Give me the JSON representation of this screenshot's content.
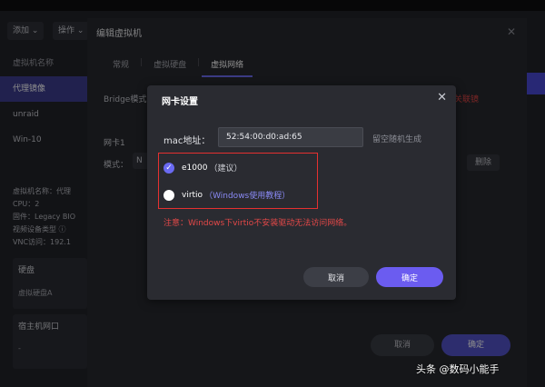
{
  "toolbar": {
    "add": "添加 ⌄",
    "ops": "操作 ⌄"
  },
  "vm_list": {
    "header": "虚拟机名称",
    "items": [
      "代理镜像",
      "unraid",
      "Win-10"
    ]
  },
  "vm_info": {
    "lines": [
      "虚拟机名称：代理",
      "CPU：2",
      "固件：Legacy BIO",
      "视频设备类型 ⓘ",
      "VNC访问：192.1"
    ],
    "disk_title": "硬盘",
    "disk_value": "虚拟硬盘A",
    "port_title": "宿主机网口",
    "port_value": "-"
  },
  "edit_dialog": {
    "title": "编辑虚拟机",
    "tabs": [
      "常规",
      "虚拟硬盘",
      "虚拟网络"
    ],
    "bridge_text": "Bridge模式",
    "warn_side": "关联镜",
    "nic_header": "网卡1",
    "mode_label": "模式：",
    "mode_value": "N",
    "delete_label": "删除",
    "cancel_label": "取消",
    "ok_label": "确定"
  },
  "nic_dialog": {
    "title": "网卡设置",
    "mac_label": "mac地址：",
    "mac_value": "52:54:00:d0:ad:65",
    "mac_hint": "留空随机生成",
    "options": [
      {
        "name": "e1000",
        "note": "（建议）",
        "checked": true
      },
      {
        "name": "virtio",
        "link": "（Windows使用教程）",
        "checked": false
      }
    ],
    "notice": "注意：Windows下virtio不安装驱动无法访问网络。",
    "cancel_label": "取消",
    "ok_label": "确定"
  },
  "watermark": "头条 @数码小能手",
  "colors": {
    "accent": "#6b5cf0",
    "warning": "#e34848",
    "highlight_box": "#e53030"
  }
}
